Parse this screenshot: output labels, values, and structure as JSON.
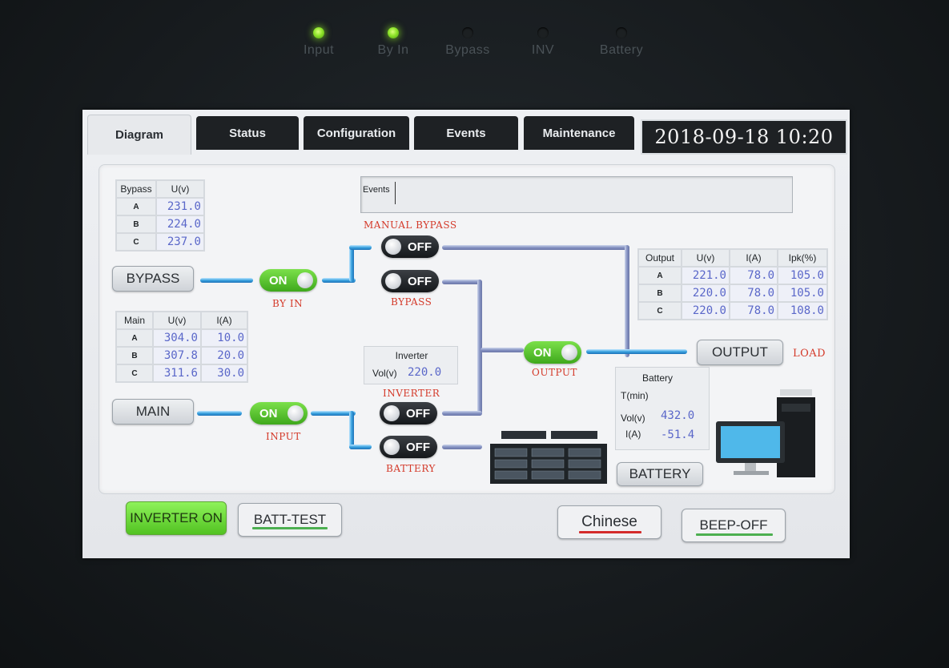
{
  "leds": [
    {
      "label": "Input",
      "on": true
    },
    {
      "label": "By In",
      "on": true
    },
    {
      "label": "Bypass",
      "on": false
    },
    {
      "label": "INV",
      "on": false
    },
    {
      "label": "Battery",
      "on": false
    }
  ],
  "tabs": [
    "Diagram",
    "Status",
    "Configuration",
    "Events",
    "Maintenance"
  ],
  "active_tab": "Diagram",
  "clock": "2018-09-18  10:20",
  "events_label": "Events",
  "bypass_table": {
    "headers": [
      "Bypass",
      "U(v)"
    ],
    "rows": [
      {
        "phase": "A",
        "u": "231.0"
      },
      {
        "phase": "B",
        "u": "224.0"
      },
      {
        "phase": "C",
        "u": "237.0"
      }
    ]
  },
  "main_table": {
    "headers": [
      "Main",
      "U(v)",
      "I(A)"
    ],
    "rows": [
      {
        "phase": "A",
        "u": "304.0",
        "i": "10.0"
      },
      {
        "phase": "B",
        "u": "307.8",
        "i": "20.0"
      },
      {
        "phase": "C",
        "u": "311.6",
        "i": "30.0"
      }
    ]
  },
  "output_table": {
    "headers": [
      "Output",
      "U(v)",
      "I(A)",
      "Ipk(%)"
    ],
    "rows": [
      {
        "phase": "A",
        "u": "221.0",
        "i": "78.0",
        "ipk": "105.0"
      },
      {
        "phase": "B",
        "u": "220.0",
        "i": "78.0",
        "ipk": "105.0"
      },
      {
        "phase": "C",
        "u": "220.0",
        "i": "78.0",
        "ipk": "108.0"
      }
    ]
  },
  "inverter_box": {
    "title": "Inverter",
    "vol_label": "Vol(v)",
    "vol": "220.0"
  },
  "battery_box": {
    "title": "Battery",
    "t_label": "T(min)",
    "t": "",
    "vol_label": "Vol(v)",
    "vol": "432.0",
    "i_label": "I(A)",
    "i": "-51.4"
  },
  "switches": {
    "by_in": {
      "state": "ON",
      "label": "BY IN"
    },
    "manual_bypass": {
      "state": "OFF",
      "label": "MANUAL BYPASS"
    },
    "bypass": {
      "state": "OFF",
      "label": "BYPASS"
    },
    "input": {
      "state": "ON",
      "label": "INPUT"
    },
    "inverter": {
      "state": "OFF",
      "label": "INVERTER"
    },
    "battery": {
      "state": "OFF",
      "label": "BATTERY"
    },
    "output": {
      "state": "ON",
      "label": "OUTPUT"
    }
  },
  "buttons": {
    "bypass": "BYPASS",
    "main": "MAIN",
    "output": "OUTPUT",
    "battery": "BATTERY",
    "inverter_on": "INVERTER ON",
    "batt_test": "BATT-TEST",
    "chinese": "Chinese",
    "beep_off": "BEEP-OFF"
  },
  "load_label": "LOAD",
  "colors": {
    "on_green": "#3ea81c",
    "label_red": "#d43a2a",
    "value_blue": "#5a67c9",
    "bus_blue": "#3aa3e0"
  }
}
